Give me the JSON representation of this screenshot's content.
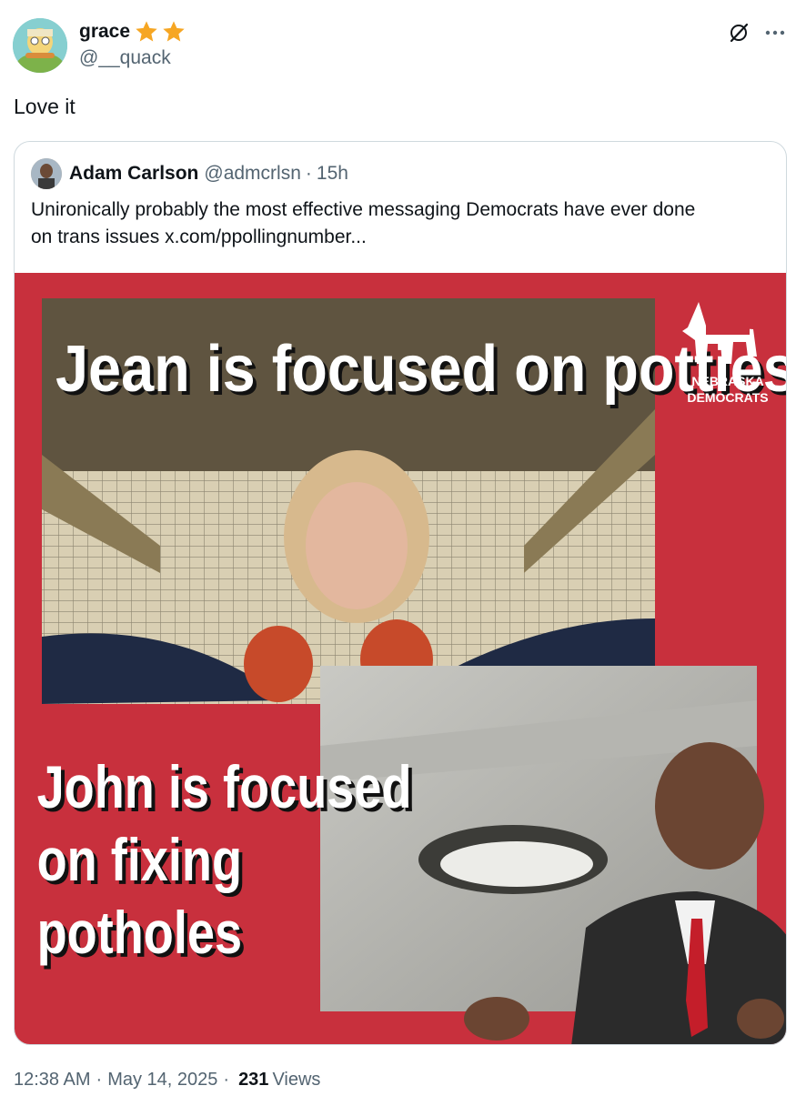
{
  "tweet": {
    "display_name": "grace",
    "handle": "@__quack",
    "text": "Love it",
    "icons": {
      "badge": "star-icon",
      "grok": "grok-icon",
      "more": "more-icon"
    }
  },
  "quote": {
    "display_name": "Adam Carlson",
    "handle": "@admcrlsn",
    "separator": "·",
    "time": "15h",
    "text_line1": "Unironically probably the most effective messaging Democrats have ever done",
    "text_line2": "on trans issues  x.com/ppollingnumber...",
    "image": {
      "headline_top": "Jean is focused on potties",
      "headline_bottom_1": "John is focused",
      "headline_bottom_2": "on fixing",
      "headline_bottom_3": "potholes",
      "logo_line1": "NEBRASKA",
      "logo_line2": "DEMOCRATS"
    }
  },
  "meta": {
    "time": "12:38 AM",
    "date": "May 14, 2025",
    "separator": "·",
    "views_count": "231",
    "views_label": "Views"
  },
  "colors": {
    "poster_red": "#c8303d",
    "text_primary": "#0f1419",
    "text_secondary": "#536471",
    "star": "#f6a623"
  }
}
